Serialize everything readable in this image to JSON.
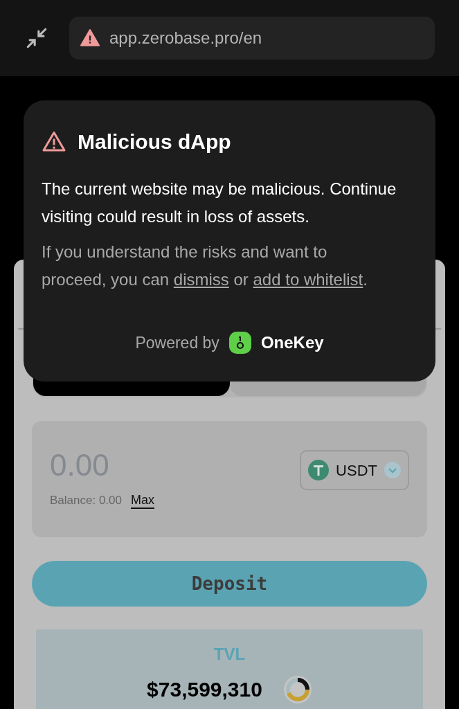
{
  "browser": {
    "url": "app.zerobase.pro/en",
    "insecure": true
  },
  "warning": {
    "title": "Malicious dApp",
    "message": "The current website may be malicious. Continue visiting could result in loss of assets.",
    "hint_before": "If you understand the risks and want to proceed, you can",
    "dismiss_link": "dismiss",
    "hint_middle": "or",
    "whitelist_link": "add to whitelist",
    "hint_end": ".",
    "powered_by": "Powered by",
    "brand": "OneKey"
  },
  "tabs": [
    {
      "selected": true
    },
    {
      "selected": false
    }
  ],
  "amount": {
    "placeholder": "0.00",
    "balance": "Balance: 0.00",
    "max": "Max",
    "token": "USDT"
  },
  "deposit_button": "Deposit",
  "tvl": {
    "label": "TVL",
    "value": "$73,599,310"
  }
}
